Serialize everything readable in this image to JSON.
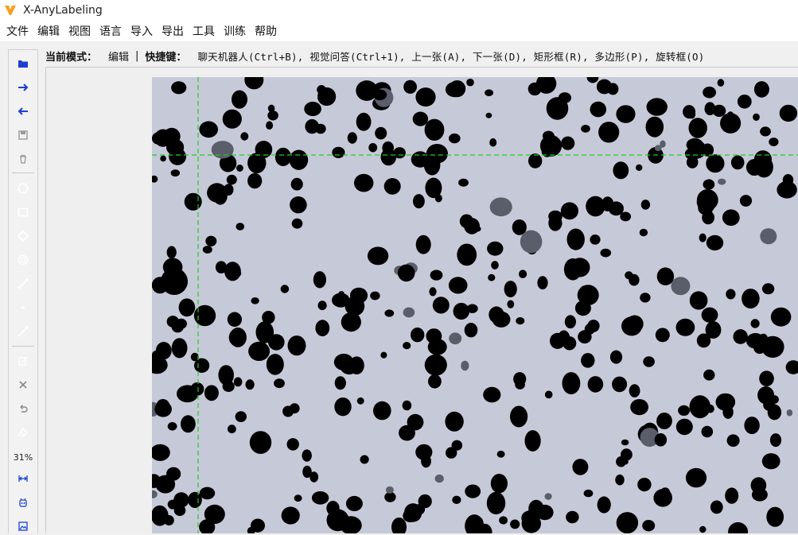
{
  "app": {
    "title": "X-AnyLabeling",
    "logo_icon": "x-anylabeling-logo-icon",
    "accent_color": "#f5a01b"
  },
  "menu": [
    {
      "label": "文件"
    },
    {
      "label": "编辑"
    },
    {
      "label": "视图"
    },
    {
      "label": "语言"
    },
    {
      "label": "导入"
    },
    {
      "label": "导出"
    },
    {
      "label": "工具"
    },
    {
      "label": "训练"
    },
    {
      "label": "帮助"
    }
  ],
  "toolbar": {
    "zoom": "31%",
    "buttons": [
      {
        "icon": "open-folder-icon",
        "name": "open-button",
        "enabled": true
      },
      {
        "icon": "next-arrow-icon",
        "name": "next-image-button",
        "enabled": true
      },
      {
        "icon": "prev-arrow-icon",
        "name": "prev-image-button",
        "enabled": true
      },
      {
        "icon": "save-icon",
        "name": "save-button",
        "enabled": false
      },
      {
        "icon": "delete-icon",
        "name": "delete-file-button",
        "enabled": false
      },
      {
        "icon": "polygon-icon",
        "name": "create-polygon-button",
        "enabled": true
      },
      {
        "icon": "rectangle-icon",
        "name": "create-rectangle-button",
        "enabled": true
      },
      {
        "icon": "rotation-icon",
        "name": "create-rotation-button",
        "enabled": true
      },
      {
        "icon": "circle-icon",
        "name": "create-circle-button",
        "enabled": true
      },
      {
        "icon": "line-icon",
        "name": "create-line-button",
        "enabled": true
      },
      {
        "icon": "point-icon",
        "name": "create-point-button",
        "enabled": true
      },
      {
        "icon": "linestrip-icon",
        "name": "create-linestrip-button",
        "enabled": true
      },
      {
        "icon": "edit-icon",
        "name": "edit-mode-button",
        "enabled": true
      },
      {
        "icon": "close-icon",
        "name": "delete-shape-button",
        "enabled": false
      },
      {
        "icon": "undo-icon",
        "name": "undo-button",
        "enabled": false
      },
      {
        "icon": "brightness-icon",
        "name": "brightness-contrast-button",
        "enabled": true
      },
      {
        "icon": "fit-width-icon",
        "name": "fit-width-button",
        "enabled": true
      },
      {
        "icon": "auto-label-icon",
        "name": "auto-labeling-button",
        "enabled": true
      },
      {
        "icon": "image-icon",
        "name": "image-tool-button",
        "enabled": true
      }
    ]
  },
  "mode_bar": {
    "mode_key": "当前模式：",
    "mode_value": "编辑",
    "separator": "|",
    "shortcut_key": "快捷键：",
    "shortcuts": "聊天机器人(Ctrl+B), 视觉问答(Ctrl+1), 上一张(A), 下一张(D), 矩形框(R), 多边形(P), 旋转框(O)"
  },
  "canvas": {
    "image_bg": "#c6cad8",
    "blob_color": "#000000",
    "crosshair_color": "#22cc22"
  }
}
